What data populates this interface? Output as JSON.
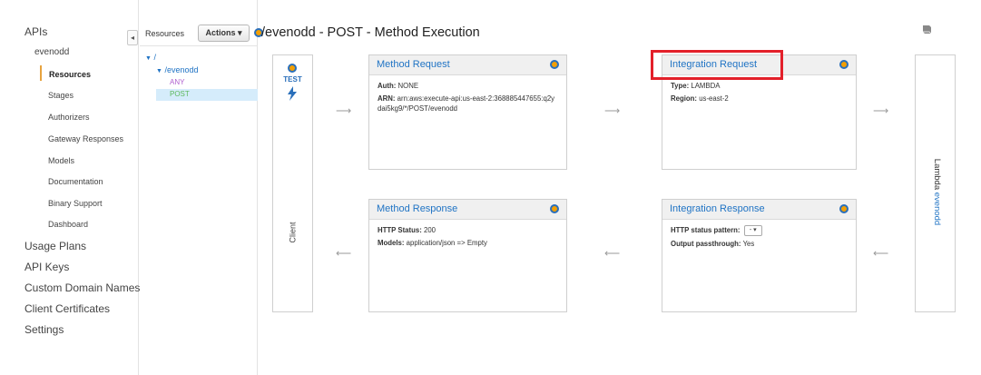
{
  "nav": {
    "apis": "APIs",
    "api_name": "evenodd",
    "sub_items": [
      "Resources",
      "Stages",
      "Authorizers",
      "Gateway Responses",
      "Models",
      "Documentation",
      "Binary Support",
      "Dashboard"
    ],
    "items": [
      "Usage Plans",
      "API Keys",
      "Custom Domain Names",
      "Client Certificates",
      "Settings"
    ],
    "collapse": "◂"
  },
  "tree": {
    "title": "Resources",
    "actions": "Actions ▾",
    "root": "/",
    "resource": "/evenodd",
    "method_any": "ANY",
    "method_post": "POST"
  },
  "header": {
    "title": "/evenodd - POST - Method Execution"
  },
  "client": {
    "test": "TEST",
    "label": "Client"
  },
  "lambda": {
    "prefix": "Lambda ",
    "name": "evenodd"
  },
  "method_request": {
    "title": "Method Request",
    "auth_label": "Auth:",
    "auth_value": "NONE",
    "arn_label": "ARN:",
    "arn_value": "arn:aws:execute-api:us-east-2:368885447655:q2ydai5kg9/*/POST/evenodd"
  },
  "integration_request": {
    "title": "Integration Request",
    "type_label": "Type:",
    "type_value": "LAMBDA",
    "region_label": "Region:",
    "region_value": "us-east-2"
  },
  "method_response": {
    "title": "Method Response",
    "status_label": "HTTP Status:",
    "status_value": "200",
    "models_label": "Models:",
    "models_value": "application/json => Empty"
  },
  "integration_response": {
    "title": "Integration Response",
    "pattern_label": "HTTP status pattern:",
    "pattern_value": "-",
    "passthrough_label": "Output passthrough:",
    "passthrough_value": "Yes"
  },
  "arrows": {
    "right": "⟶",
    "left": "⟵"
  },
  "colors": {
    "accent": "#1f73c4",
    "dot": "#f29f05",
    "highlight": "#e3202a",
    "post": "#5cb85c",
    "any": "#b05fcf"
  },
  "icons": [
    "collapse-icon",
    "method-dot-icon",
    "lightning-bolt-icon",
    "book-icon",
    "arrow-right-icon",
    "arrow-left-icon",
    "chevron-down-icon"
  ]
}
